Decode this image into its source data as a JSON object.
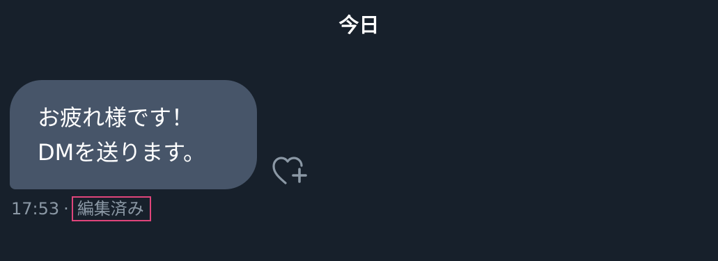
{
  "conversation": {
    "date_separator": "今日"
  },
  "message": {
    "lines": [
      "お疲れ様です！",
      "DMを送ります。"
    ],
    "time": "17:53",
    "separator": "·",
    "edited_label": "編集済み",
    "bubble_color": "#475569"
  },
  "reaction": {
    "icon": "heart-plus-icon"
  },
  "colors": {
    "background": "#17202b",
    "meta_text": "#8b98a5",
    "highlight": "#e0457b"
  }
}
